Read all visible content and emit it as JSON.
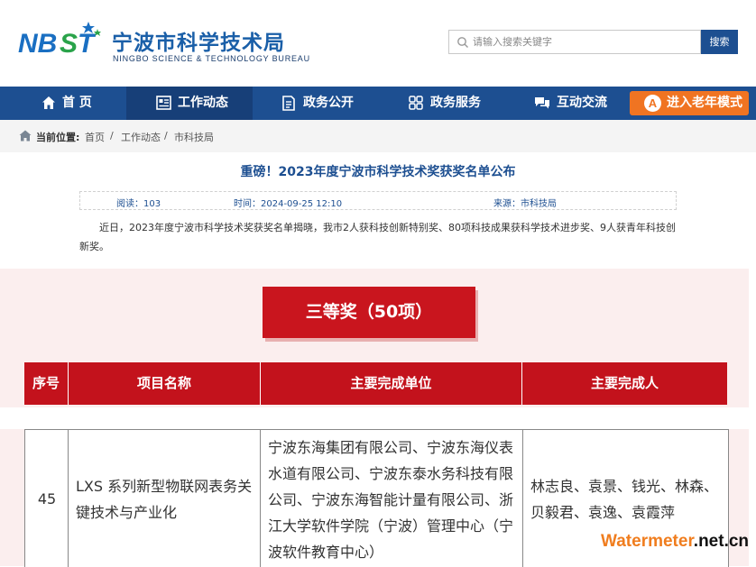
{
  "header": {
    "logo_text": "NBST",
    "site_title": "宁波市科学技术局",
    "site_subtitle": "NINGBO SCIENCE & TECHNOLOGY BUREAU",
    "search_placeholder": "请输入搜索关键字",
    "search_button": "搜索"
  },
  "nav": {
    "items": [
      {
        "label": "首 页",
        "icon": "home-icon"
      },
      {
        "label": "工作动态",
        "icon": "news-icon"
      },
      {
        "label": "政务公开",
        "icon": "document-icon"
      },
      {
        "label": "政务服务",
        "icon": "grid-icon"
      },
      {
        "label": "互动交流",
        "icon": "chat-icon"
      }
    ],
    "elder_mode": {
      "badge": "A",
      "label": "进入老年模式"
    }
  },
  "breadcrumb": {
    "prefix": "当前位置:",
    "items": [
      "首页",
      "工作动态",
      "市科技局"
    ],
    "separator": "/"
  },
  "article": {
    "title": "重磅！2023年度宁波市科学技术奖获奖名单公布",
    "reads": "阅读：103",
    "time": "时间：2024-09-25 12:10",
    "source": "来源：市科技局",
    "paragraph": "近日，2023年度宁波市科学技术奖获奖名单揭晓，我市2人获科技创新特别奖、80项科技成果获科学技术进步奖、9人获青年科技创新奖。"
  },
  "award": {
    "banner": "三等奖（50项）",
    "columns": [
      "序号",
      "项目名称",
      "主要完成单位",
      "主要完成人"
    ],
    "row": {
      "no": "45",
      "project": "LXS 系列新型物联网表务关键技术与产业化",
      "units": "宁波东海集团有限公司、宁波东海仪表水道有限公司、宁波东泰水务科技有限公司、宁波东海智能计量有限公司、浙江大学软件学院（宁波）管理中心（宁波软件教育中心）",
      "people": "林志良、袁景、钱光、林森、贝毅君、袁逸、袁霞萍"
    }
  },
  "watermark": {
    "a": "Watermeter",
    "b": ".net.cn"
  },
  "colors": {
    "primary": "#1d4f91",
    "accent": "#f07422",
    "award_red": "#c3121c"
  }
}
